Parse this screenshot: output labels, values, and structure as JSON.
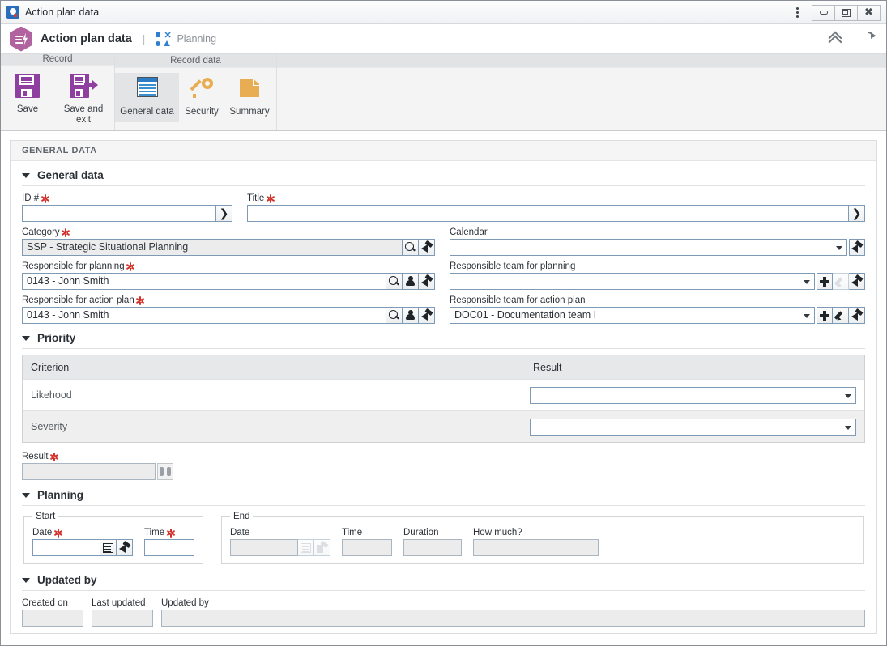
{
  "window": {
    "title": "Action plan data",
    "minimize_label": "Minimize",
    "maximize_label": "Restore",
    "close_label": "Close",
    "menu_label": "More options"
  },
  "header": {
    "app_title": "Action plan data",
    "separator": "|",
    "process_name": "Planning",
    "collapse_label": "Collapse",
    "refresh_label": "Refresh",
    "brand_color": "#b0639f",
    "process_icon_color": "#2f7fd1"
  },
  "ribbon": {
    "groups": [
      {
        "title": "Record",
        "buttons": [
          {
            "label": "Save",
            "icon": "save-icon",
            "active": false
          },
          {
            "label": "Save and exit",
            "icon": "save-and-exit-icon",
            "active": false
          }
        ]
      },
      {
        "title": "Record data",
        "buttons": [
          {
            "label": "General data",
            "icon": "general-data-icon",
            "active": true
          },
          {
            "label": "Security",
            "icon": "key-icon",
            "active": false
          },
          {
            "label": "Summary",
            "icon": "summary-page-icon",
            "active": false
          }
        ]
      }
    ]
  },
  "page": {
    "caption": "GENERAL DATA"
  },
  "sections": {
    "general": {
      "title": "General data",
      "id": {
        "label": "ID #",
        "required": true,
        "value": "",
        "button": "next-arrow-icon"
      },
      "title_field": {
        "label": "Title",
        "required": true,
        "value": "",
        "button": "next-arrow-icon"
      },
      "category": {
        "label": "Category",
        "required": true,
        "value": "SSP - Strategic Situational Planning",
        "readonly": true,
        "buttons": [
          "search-icon",
          "clear-brush-icon"
        ]
      },
      "calendar": {
        "label": "Calendar",
        "required": false,
        "value": "",
        "buttons": [
          "clear-brush-icon"
        ]
      },
      "resp_planning": {
        "label": "Responsible for planning",
        "required": true,
        "value": "0143 - John Smith",
        "buttons": [
          "search-icon",
          "person-icon",
          "clear-brush-icon"
        ]
      },
      "resp_team_planning": {
        "label": "Responsible team for planning",
        "required": false,
        "value": "",
        "buttons": [
          "add-icon",
          "edit-pencil-icon",
          "clear-brush-icon"
        ],
        "edit_disabled": true
      },
      "resp_action_plan": {
        "label": "Responsible for action plan",
        "required": true,
        "value": "0143 - John Smith",
        "buttons": [
          "search-icon",
          "person-icon",
          "clear-brush-icon"
        ]
      },
      "resp_team_action_plan": {
        "label": "Responsible team for action plan",
        "required": false,
        "value": "DOC01 - Documentation team I",
        "buttons": [
          "add-icon",
          "edit-pencil-icon",
          "clear-brush-icon"
        ],
        "edit_disabled": false
      }
    },
    "priority": {
      "title": "Priority",
      "columns": [
        "Criterion",
        "Result"
      ],
      "rows": [
        {
          "criterion": "Likehood",
          "result": ""
        },
        {
          "criterion": "Severity",
          "result": ""
        }
      ],
      "result": {
        "label": "Result",
        "required": true,
        "value": "",
        "button": "binoculars-icon"
      }
    },
    "planning": {
      "title": "Planning",
      "start": {
        "legend": "Start",
        "date": {
          "label": "Date",
          "required": true,
          "value": "",
          "buttons": [
            "calendar-icon",
            "clear-brush-icon"
          ]
        },
        "time": {
          "label": "Time",
          "required": true,
          "value": ""
        }
      },
      "end": {
        "legend": "End",
        "date": {
          "label": "Date",
          "required": false,
          "value": "",
          "readonly": true,
          "buttons": [
            "calendar-icon",
            "clear-brush-icon"
          ]
        },
        "time": {
          "label": "Time",
          "required": false,
          "value": "",
          "readonly": true
        },
        "duration": {
          "label": "Duration",
          "required": false,
          "value": "",
          "readonly": true
        },
        "how_much": {
          "label": "How much?",
          "required": false,
          "value": "",
          "readonly": true
        }
      }
    },
    "updated": {
      "title": "Updated by",
      "created_on": {
        "label": "Created on",
        "value": "",
        "readonly": true
      },
      "last_updated": {
        "label": "Last updated",
        "value": "",
        "readonly": true
      },
      "updated_by": {
        "label": "Updated by",
        "value": "",
        "readonly": true
      }
    }
  }
}
